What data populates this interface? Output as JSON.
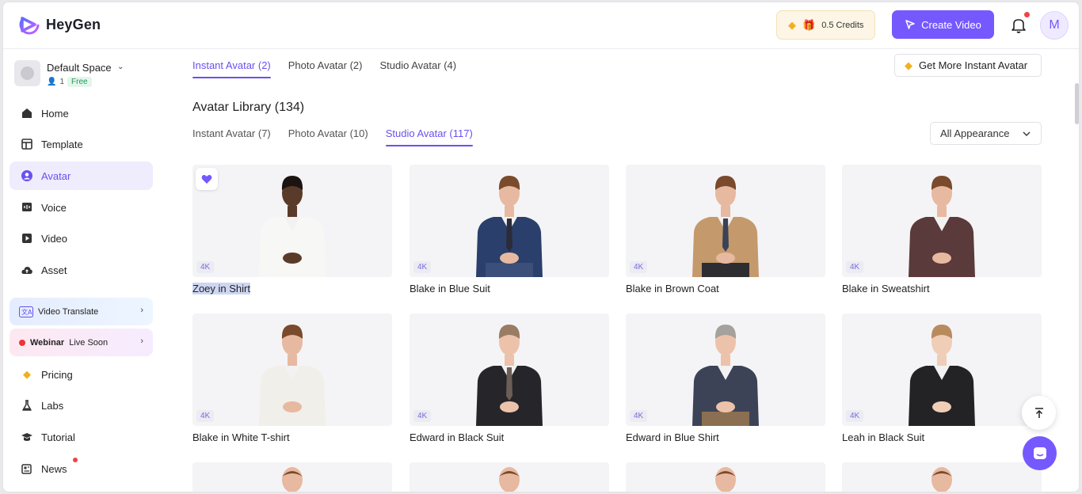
{
  "header": {
    "brand": "HeyGen",
    "credits_label": "0.5 Credits",
    "create_button": "Create Video",
    "avatar_initial": "M"
  },
  "sidebar": {
    "space_name": "Default Space",
    "member_count": "1",
    "plan_badge": "Free",
    "items": [
      {
        "label": "Home",
        "icon": "home-icon"
      },
      {
        "label": "Template",
        "icon": "template-icon"
      },
      {
        "label": "Avatar",
        "icon": "avatar-icon",
        "active": true
      },
      {
        "label": "Voice",
        "icon": "voice-icon"
      },
      {
        "label": "Video",
        "icon": "video-icon"
      },
      {
        "label": "Asset",
        "icon": "cloud-icon"
      }
    ],
    "promo_translate": "Video Translate",
    "promo_webinar_bold": "Webinar",
    "promo_webinar_rest": "Live Soon",
    "bottom_items": [
      {
        "label": "Pricing",
        "icon": "diamond-icon"
      },
      {
        "label": "Labs",
        "icon": "flask-icon"
      },
      {
        "label": "Tutorial",
        "icon": "graduation-icon"
      },
      {
        "label": "News",
        "icon": "news-icon"
      }
    ]
  },
  "main": {
    "top_tabs": [
      "Instant Avatar (2)",
      "Photo Avatar (2)",
      "Studio Avatar (4)"
    ],
    "more_button": "Get More Instant Avatar",
    "library_title": "Avatar Library (134)",
    "library_tabs": [
      "Instant Avatar (7)",
      "Photo Avatar (10)",
      "Studio Avatar (117)"
    ],
    "appearance_select": "All Appearance",
    "quality_badge": "4K",
    "avatars": [
      {
        "name": "Zoey in Shirt",
        "skin": "#5a3b2a",
        "hair": "#1b1411",
        "top": "#f7f7f5",
        "bottom": "#f7f7f5",
        "tie": ""
      },
      {
        "name": "Blake in Blue Suit",
        "skin": "#e7b9a0",
        "hair": "#7a4a2c",
        "top": "#2a3f6b",
        "bottom": "#3b4f7a",
        "tie": "#2b2b3a"
      },
      {
        "name": "Blake in Brown Coat",
        "skin": "#e7b9a0",
        "hair": "#7a4a2c",
        "top": "#c49a6c",
        "bottom": "#2e2e32",
        "tie": "#3a4257"
      },
      {
        "name": "Blake in Sweatshirt",
        "skin": "#e7b9a0",
        "hair": "#7a4a2c",
        "top": "#5a3a3a",
        "bottom": "#5a3a3a",
        "tie": ""
      },
      {
        "name": "Blake in White T-shirt",
        "skin": "#e7b9a0",
        "hair": "#7a4a2c",
        "top": "#f1efe9",
        "bottom": "#f1efe9",
        "tie": ""
      },
      {
        "name": "Edward in Black Suit",
        "skin": "#edc2ab",
        "hair": "#9a7c64",
        "top": "#26262a",
        "bottom": "#26262a",
        "tie": "#6b5e57"
      },
      {
        "name": "Edward in Blue Shirt",
        "skin": "#edc2ab",
        "hair": "#a5a19c",
        "top": "#3c4356",
        "bottom": "#8b6f52",
        "tie": ""
      },
      {
        "name": "Leah in Black Suit",
        "skin": "#f0cdb6",
        "hair": "#b88b5e",
        "top": "#232325",
        "bottom": "#232325",
        "tie": ""
      }
    ],
    "peek_avatars": [
      {
        "skin": "#e7b9a0",
        "hair": "#7a4a2c"
      },
      {
        "skin": "#e7b9a0",
        "hair": "#7a4a2c"
      },
      {
        "skin": "#e7b9a0",
        "hair": "#7a4a2c"
      },
      {
        "skin": "#e7b9a0",
        "hair": "#7a4a2c"
      }
    ]
  },
  "colors": {
    "accent": "#7559ff",
    "active_nav_bg": "#efecfd"
  }
}
